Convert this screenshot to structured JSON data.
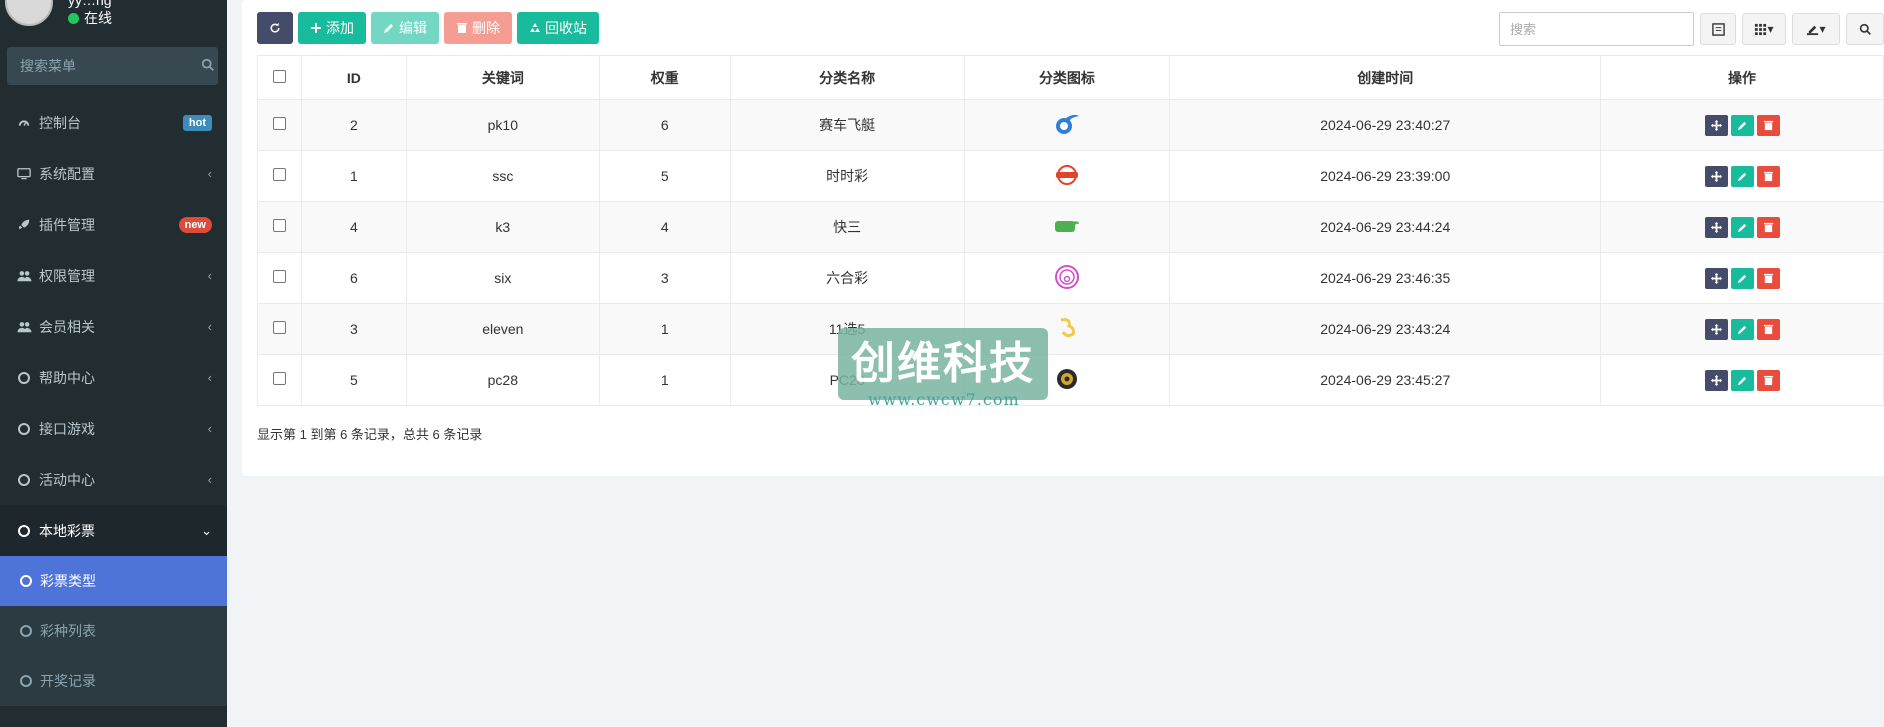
{
  "user": {
    "name": "yy…ng",
    "status": "在线"
  },
  "sidebar": {
    "search_placeholder": "搜索菜单",
    "items": [
      {
        "label": "控制台",
        "badge": "hot",
        "icon": "dashboard-icon"
      },
      {
        "label": "系统配置",
        "icon": "desktop-icon"
      },
      {
        "label": "插件管理",
        "badge": "new",
        "icon": "rocket-icon"
      },
      {
        "label": "权限管理",
        "icon": "users-icon"
      },
      {
        "label": "会员相关",
        "icon": "users-icon"
      },
      {
        "label": "帮助中心",
        "icon": "circle-icon"
      },
      {
        "label": "接口游戏",
        "icon": "circle-icon"
      },
      {
        "label": "活动中心",
        "icon": "circle-icon"
      },
      {
        "label": "本地彩票",
        "icon": "circle-icon"
      }
    ],
    "submenu": [
      {
        "label": "彩票类型",
        "active": true
      },
      {
        "label": "彩种列表"
      },
      {
        "label": "开奖记录"
      }
    ]
  },
  "toolbar": {
    "add_label": "添加",
    "edit_label": "编辑",
    "delete_label": "删除",
    "recycle_label": "回收站",
    "search_placeholder": "搜索"
  },
  "table": {
    "headers": {
      "id": "ID",
      "keyword": "关键词",
      "weight": "权重",
      "name": "分类名称",
      "icon": "分类图标",
      "created": "创建时间",
      "ops": "操作"
    },
    "rows": [
      {
        "id": "2",
        "keyword": "pk10",
        "weight": "6",
        "name": "赛车飞艇",
        "icon": "pk10",
        "created": "2024-06-29 23:40:27"
      },
      {
        "id": "1",
        "keyword": "ssc",
        "weight": "5",
        "name": "时时彩",
        "icon": "ssc",
        "created": "2024-06-29 23:39:00"
      },
      {
        "id": "4",
        "keyword": "k3",
        "weight": "4",
        "name": "快三",
        "icon": "k3",
        "created": "2024-06-29 23:44:24"
      },
      {
        "id": "6",
        "keyword": "six",
        "weight": "3",
        "name": "六合彩",
        "icon": "six",
        "created": "2024-06-29 23:46:35"
      },
      {
        "id": "3",
        "keyword": "eleven",
        "weight": "1",
        "name": "11选5",
        "icon": "eleven",
        "created": "2024-06-29 23:43:24"
      },
      {
        "id": "5",
        "keyword": "pc28",
        "weight": "1",
        "name": "PC28",
        "icon": "pc28",
        "created": "2024-06-29 23:45:27"
      }
    ]
  },
  "pager_text": "显示第 1 到第 6 条记录，总共 6 条记录",
  "watermark": {
    "title": "创维科技",
    "url": "www.cwcw7.com"
  },
  "colors": {
    "sidebar_bg": "#222d32",
    "active": "#4f74d9",
    "success": "#18bc9c",
    "danger": "#e74c3c",
    "dark": "#444c69"
  }
}
